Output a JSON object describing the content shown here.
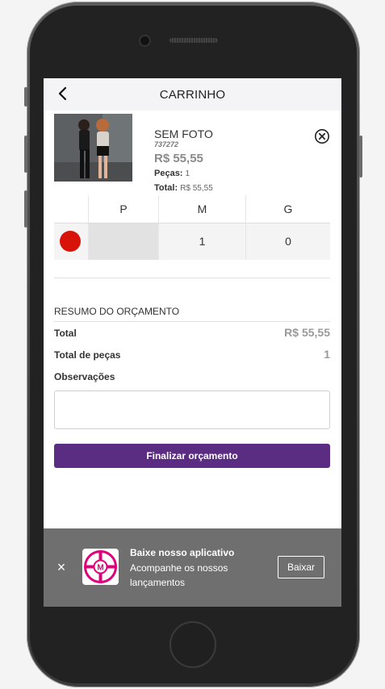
{
  "header": {
    "title": "CARRINHO",
    "back_icon": "back-arrow-icon"
  },
  "product": {
    "name": "SEM FOTO",
    "code": "737272",
    "price": "R$ 55,55",
    "qty_label": "Peças:",
    "qty_value": "1",
    "total_label": "Total:",
    "total_value": "R$ 55,55",
    "remove_icon": "close-circle-icon"
  },
  "size_grid": {
    "headers": [
      "P",
      "M",
      "G"
    ],
    "rows": [
      {
        "color": "#d8140a",
        "values": [
          "",
          "1",
          "0"
        ]
      }
    ]
  },
  "summary": {
    "title": "RESUMO DO ORÇAMENTO",
    "total_label": "Total",
    "total_value": "R$ 55,55",
    "pieces_label": "Total de peças",
    "pieces_value": "1",
    "notes_label": "Observações"
  },
  "actions": {
    "submit_label": "Finalizar orçamento"
  },
  "app_banner": {
    "title": "Baixe nosso aplicativo",
    "subtitle": "Acompanhe os nossos lançamentos",
    "button_label": "Baixar",
    "close_label": "×",
    "logo_color": "#e0007a"
  },
  "colors": {
    "accent": "#5b2d82",
    "banner_bg": "#6f6f6f"
  }
}
